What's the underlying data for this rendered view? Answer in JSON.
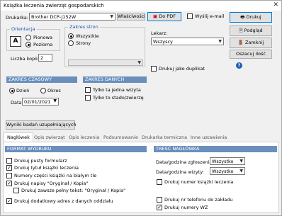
{
  "window": {
    "title": "Książka leczenia zwierząt gospodarskich",
    "close": "✕"
  },
  "printer": {
    "label": "Drukarka:",
    "value": "Brother DCP-J152W",
    "properties": "Właściwości"
  },
  "orientation": {
    "title": "Orientacja",
    "portrait": "Pionowa",
    "landscape": "Pozioma"
  },
  "range": {
    "title": "Zakres stron",
    "all": "Wszystkie",
    "pages": "Strony"
  },
  "copies": {
    "label": "Liczba kopii:",
    "value": "2"
  },
  "email": {
    "label": "Wyślij e-mail"
  },
  "pdf": {
    "label": "Do PDF"
  },
  "doctor": {
    "label": "Lekarz:",
    "value": "Wszyscy"
  },
  "duplicate": {
    "label": "Drukuj jako duplikat"
  },
  "actions": {
    "print": "Drukuj",
    "preview": "Podgląd",
    "close": "Zamknij",
    "remember": "Oszacuj ilość",
    "help": "?"
  },
  "time_range": {
    "title": "ZAKRES CZASOWY",
    "day": "Dzień",
    "period": "Okres",
    "date_label": "Data:",
    "date_value": "02/01/2021"
  },
  "data_range": {
    "title": "ZAKRES DANYCH",
    "only_one": "Tylko ta jedna wizyta",
    "herd": "Tylko to stado/zwierzę"
  },
  "results_btn": "Wyniki badań uzupełniających",
  "tabs": [
    "Nagłówek",
    "Opis zwierząt",
    "Opis leczenia",
    "Podsumowanie",
    "Drukarka termiczna",
    "Inne ustawienia"
  ],
  "print_format": {
    "title": "FORMAT WYDRUKU",
    "items": [
      {
        "label": "Drukuj pusty formularz",
        "checked": false
      },
      {
        "label": "Drukuj tytuł książki leczenia",
        "checked": true
      },
      {
        "label": "Numery części książki na białym tle",
        "checked": false
      },
      {
        "label": "Drukuj napisy \"Oryginał / Kopia\"",
        "checked": true
      },
      {
        "label": "Drukuj zawsze pełny tekst: \"Oryginał / Kopia\"",
        "checked": false
      },
      {
        "label": "Drukuj dodatkowy adres z danych oddziału",
        "checked": true
      }
    ]
  },
  "header_content": {
    "title": "TREŚĆ NAGŁÓWKA",
    "report_label": "Data/godzina zgłoszenia:",
    "report_value": "Wszystko",
    "visit_label": "Data/godzina wizyty:",
    "visit_value": "Wszystko",
    "book_number": {
      "label": "Drukuj numer książki leczenia",
      "checked": false
    },
    "phone": {
      "label": "Drukuj nr telefonu do zakładu",
      "checked": false
    },
    "wz": {
      "label": "Drukuj numery WZ",
      "checked": true
    }
  }
}
